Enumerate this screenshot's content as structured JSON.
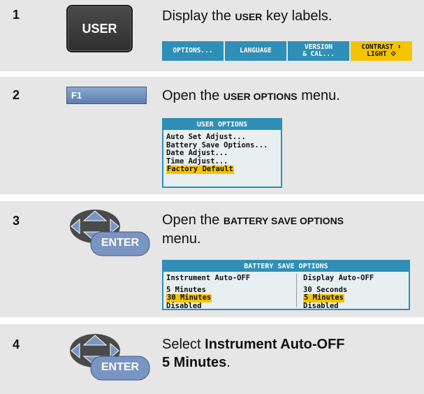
{
  "steps": [
    {
      "number": "1",
      "key_label": "USER",
      "text_pre": "Display the ",
      "text_bold": "USER",
      "text_post": " key labels.",
      "softkeys": [
        {
          "line1": "OPTIONS...",
          "line2": ""
        },
        {
          "line1": "LANGUAGE",
          "line2": ""
        },
        {
          "line1": "VERSION",
          "line2": "& CAL..."
        },
        {
          "line1": "CONTRAST ⬍",
          "line2": "LIGHT ⟐"
        }
      ]
    },
    {
      "number": "2",
      "key_label": "F1",
      "text_pre": "Open the ",
      "text_bold": "USER OPTIONS",
      "text_post": " menu.",
      "menu_title": "USER OPTIONS",
      "menu_items": [
        "Auto Set Adjust...",
        "Battery Save Options...",
        "Date Adjust...",
        "Time Adjust..."
      ],
      "menu_selected": "Factory Default"
    },
    {
      "number": "3",
      "key_label": "ENTER",
      "text_pre": "Open the ",
      "text_bold": "BATTERY SAVE OPTIONS",
      "text_post": "menu.",
      "menu_title": "BATTERY SAVE OPTIONS",
      "left_header": "Instrument Auto-OFF",
      "left_items": [
        "5 Minutes",
        "30 Minutes",
        "Disabled"
      ],
      "right_header": "Display Auto-OFF",
      "right_items": [
        "30 Seconds",
        "5 Minutes",
        "Disabled"
      ]
    },
    {
      "number": "4",
      "key_label": "ENTER",
      "text_pre": "Select ",
      "text_bold": "Instrument Auto-OFF",
      "text_bold2": "5 Minutes",
      "text_post": "."
    }
  ],
  "colors": {
    "band": "#e6e6e6",
    "menu_blue": "#2f8fb6",
    "highlight": "#f5c400"
  }
}
